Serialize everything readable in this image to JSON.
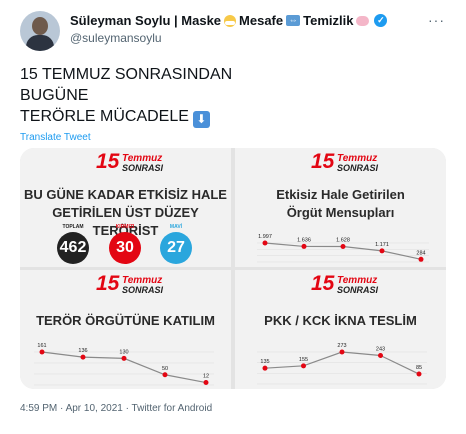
{
  "tweet": {
    "name": "Süleyman Soylu | Maske",
    "name_part2": " Mesafe",
    "name_part3": " Temizlik",
    "handle": "@suleymansoylu",
    "text_line1": "15 TEMMUZ SONRASINDAN",
    "text_line2": "BUGÜNE",
    "text_line3": "TERÖRLE MÜCADELE",
    "translate": "Translate Tweet",
    "timestamp": "4:59 PM · Apr 10, 2021 · Twitter for Android",
    "icons": [
      "mask-emoji",
      "left-right-arrow-emoji",
      "soap-emoji",
      "verified-badge",
      "more-icon",
      "down-arrow-emoji"
    ]
  },
  "logo": {
    "num": "15",
    "line1": "Temmuz",
    "line2": "SONRASI"
  },
  "panels": [
    {
      "title_l1": "BU GÜNE KADAR ETKİSİZ HALE",
      "title_l2": "GETİRİLEN ÜST DÜZEY TERÖRİST",
      "stats": [
        {
          "label": "TOPLAM",
          "value": "462",
          "color": "#222222"
        },
        {
          "label": "KIRMIZI",
          "value": "30",
          "color": "#e30613"
        },
        {
          "label": "MAVİ",
          "value": "27",
          "color": "#2aa6dd"
        }
      ]
    },
    {
      "title_l1": "Etkisiz Hale Getirilen",
      "title_l2": "Örgüt Mensupları",
      "values": [
        "1.997",
        "1.636",
        "1.628",
        "1.171",
        "284"
      ]
    },
    {
      "title_l1": "TERÖR ÖRGÜTÜNE KATILIM",
      "values": [
        "161",
        "136",
        "130",
        "50",
        "12"
      ]
    },
    {
      "title_l1": "PKK / KCK İKNA TESLİM",
      "values": [
        "135",
        "155",
        "273",
        "243",
        "85"
      ]
    }
  ],
  "chart_data": [
    {
      "type": "line",
      "values": [
        1997,
        1636,
        1628,
        1171,
        284
      ]
    },
    {
      "type": "line",
      "values": [
        161,
        136,
        130,
        50,
        12
      ]
    },
    {
      "type": "line",
      "values": [
        135,
        155,
        273,
        243,
        85
      ]
    }
  ]
}
